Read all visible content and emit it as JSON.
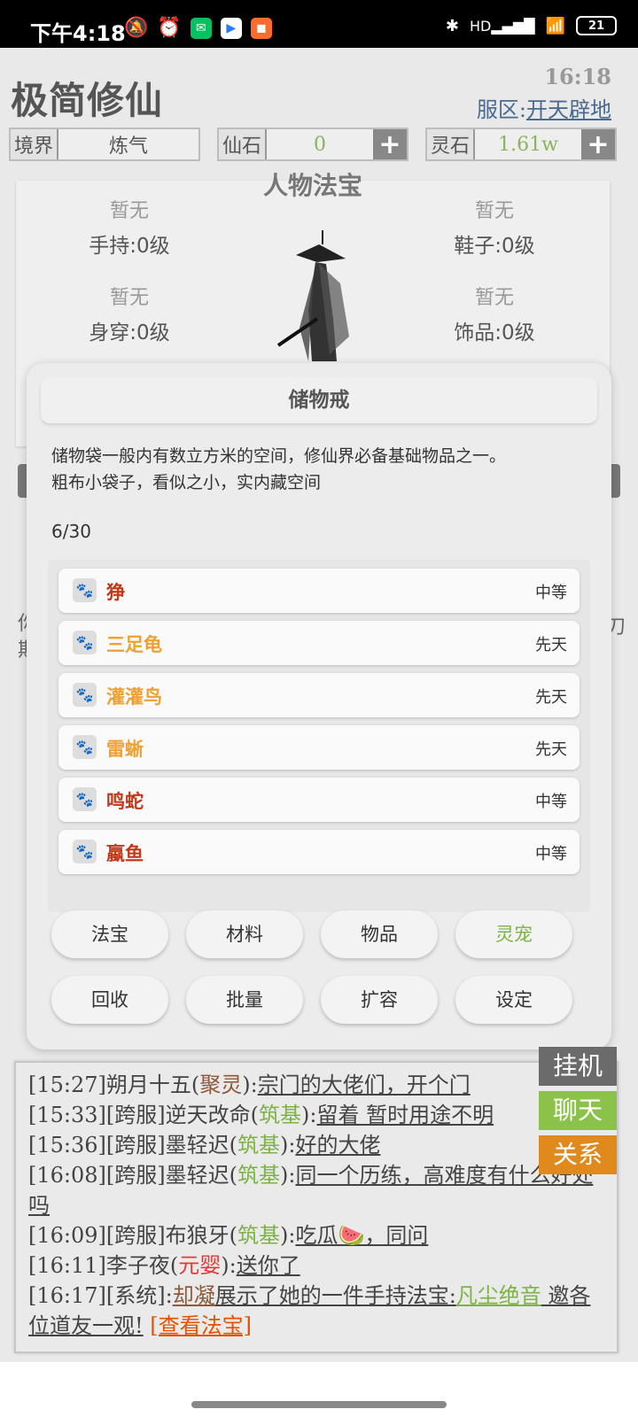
{
  "statusbar": {
    "time": "下午4:18",
    "battery": "21",
    "hd": "HD"
  },
  "header": {
    "title": "极简修仙",
    "clock": "16:18",
    "server_label": "服区:",
    "server_name": "开天辟地"
  },
  "stats": {
    "realm_label": "境界",
    "realm_value": "炼气",
    "xianshi_label": "仙石",
    "xianshi_value": "0",
    "lingshi_label": "灵石",
    "lingshi_value": "1.61w",
    "plus": "+"
  },
  "equip": {
    "title": "人物法宝",
    "slots": [
      {
        "top": "暂无",
        "bottom": "手持:0级"
      },
      {
        "top": "暂无",
        "bottom": "鞋子:0级"
      },
      {
        "top": "暂无",
        "bottom": "身穿:0级"
      },
      {
        "top": "暂无",
        "bottom": "饰品:0级"
      }
    ]
  },
  "background": {
    "left_text_1": "你",
    "left_text_2": "期",
    "right_text": "刀"
  },
  "modal": {
    "title": "储物戒",
    "desc_line1": "储物袋一般内有数立方米的空间，修仙界必备基础物品之一。",
    "desc_line2": "粗布小袋子，看似之小，实内藏空间",
    "count": "6/30",
    "items": [
      {
        "name": "狰",
        "grade": "中等",
        "color": "#c0391b"
      },
      {
        "name": "三足龟",
        "grade": "先天",
        "color": "#f0a030"
      },
      {
        "name": "灌灌鸟",
        "grade": "先天",
        "color": "#f0a030"
      },
      {
        "name": "雷蜥",
        "grade": "先天",
        "color": "#f0a030"
      },
      {
        "name": "鸣蛇",
        "grade": "中等",
        "color": "#c0391b"
      },
      {
        "name": "蠃鱼",
        "grade": "中等",
        "color": "#c0391b"
      }
    ],
    "buttons_row1": [
      "法宝",
      "材料",
      "物品",
      "灵宠"
    ],
    "buttons_row2": [
      "回收",
      "批量",
      "扩容",
      "设定"
    ],
    "active_color": "#7cb342"
  },
  "chat": {
    "lines": [
      {
        "time": "[15:27]",
        "prefix": "",
        "user": "朔月十五",
        "realm": "聚灵",
        "realm_color": "#8d5a3a",
        "msg": "宗门的大佬们，开个门"
      },
      {
        "time": "[15:33]",
        "prefix": "[跨服]",
        "user": "逆天改命",
        "realm": "筑基",
        "realm_color": "#7cb342",
        "msg": "留着 暂时用途不明"
      },
      {
        "time": "[15:36]",
        "prefix": "[跨服]",
        "user": "墨轻迟",
        "realm": "筑基",
        "realm_color": "#7cb342",
        "msg": "好的大佬"
      },
      {
        "time": "[16:08]",
        "prefix": "[跨服]",
        "user": "墨轻迟",
        "realm": "筑基",
        "realm_color": "#7cb342",
        "msg": "同一个历练，高难度有什么好处吗"
      },
      {
        "time": "[16:09]",
        "prefix": "[跨服]",
        "user": "布狼牙",
        "realm": "筑基",
        "realm_color": "#7cb342",
        "msg": "吃瓜🍉，同问"
      },
      {
        "time": "[16:11]",
        "prefix": "",
        "user": "李子夜",
        "realm": "元婴",
        "realm_color": "#e53935",
        "msg": "送你了"
      }
    ],
    "system": {
      "time": "[16:17]",
      "prefix": "[系统]:",
      "user": "却凝",
      "text1": "展示了她的一件手持法宝:",
      "treasure": "凡尘绝音",
      "text2": " 邀各位道友一观!",
      "link": "[查看法宝]"
    },
    "side_buttons": [
      {
        "label": "挂机",
        "color": "#6b6b6b"
      },
      {
        "label": "聊天",
        "color": "#8bc34a"
      },
      {
        "label": "关系",
        "color": "#e08a1e"
      }
    ]
  }
}
